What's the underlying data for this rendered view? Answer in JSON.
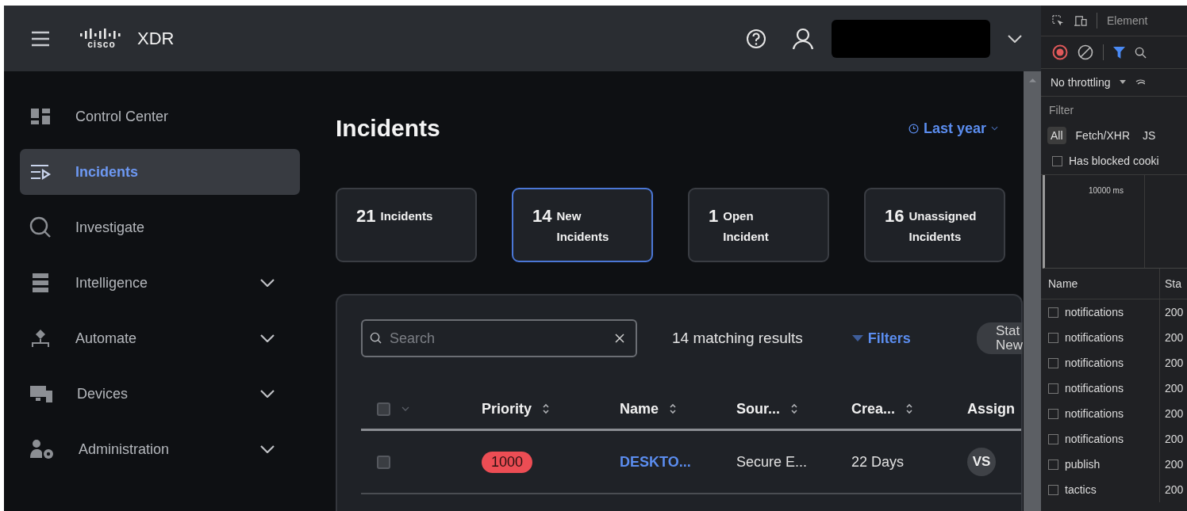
{
  "header": {
    "logo_text": "cisco",
    "product": "XDR"
  },
  "sidebar": {
    "items": [
      {
        "label": "Control Center",
        "selected": false,
        "expandable": false
      },
      {
        "label": "Incidents",
        "selected": true,
        "expandable": false
      },
      {
        "label": "Investigate",
        "selected": false,
        "expandable": false
      },
      {
        "label": "Intelligence",
        "selected": false,
        "expandable": true
      },
      {
        "label": "Automate",
        "selected": false,
        "expandable": true
      },
      {
        "label": "Devices",
        "selected": false,
        "expandable": true
      },
      {
        "label": "Administration",
        "selected": false,
        "expandable": true
      }
    ]
  },
  "page": {
    "title": "Incidents",
    "time_range": "Last year"
  },
  "stats": [
    {
      "count": "21",
      "label": "Incidents",
      "selected": false
    },
    {
      "count": "14",
      "label": "New Incidents",
      "selected": true
    },
    {
      "count": "1",
      "label": "Open Incident",
      "selected": false
    },
    {
      "count": "16",
      "label": "Unassigned Incidents",
      "selected": false
    }
  ],
  "toolbar": {
    "search_placeholder": "Search",
    "results": "14 matching results",
    "filters": "Filters",
    "status_chip": [
      "Stat",
      "New"
    ]
  },
  "table": {
    "select_all_checked": false,
    "columns": [
      {
        "label": "Priority",
        "sortable": true
      },
      {
        "label": "Name",
        "sortable": true
      },
      {
        "label": "Sour...",
        "sortable": true
      },
      {
        "label": "Crea...",
        "sortable": true
      },
      {
        "label": "Assign",
        "sortable": false
      }
    ],
    "rows": [
      {
        "checked": false,
        "priority": "1000",
        "name": "DESKTO...",
        "source": "Secure E...",
        "created": "22 Days",
        "assignee": "VS"
      }
    ]
  },
  "devtools": {
    "tab": "Element",
    "throttling": "No throttling",
    "filter_placeholder": "Filter",
    "types": [
      {
        "label": "All",
        "selected": true
      },
      {
        "label": "Fetch/XHR",
        "selected": false
      },
      {
        "label": "JS",
        "selected": false
      }
    ],
    "blocked_cookies": {
      "label": "Has blocked cooki",
      "checked": false
    },
    "timeline_tick": "10000 ms",
    "columns": [
      "Name",
      "Sta"
    ],
    "requests": [
      {
        "name": "notifications",
        "status": "200",
        "checked": false
      },
      {
        "name": "notifications",
        "status": "200",
        "checked": false
      },
      {
        "name": "notifications",
        "status": "200",
        "checked": false
      },
      {
        "name": "notifications",
        "status": "200",
        "checked": false
      },
      {
        "name": "notifications",
        "status": "200",
        "checked": false
      },
      {
        "name": "notifications",
        "status": "200",
        "checked": false
      },
      {
        "name": "publish",
        "status": "200",
        "checked": false
      },
      {
        "name": "tactics",
        "status": "200",
        "checked": false
      }
    ]
  }
}
